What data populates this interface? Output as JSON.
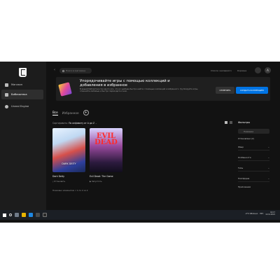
{
  "sidebar": {
    "logo": "epic-games-logo",
    "items": [
      {
        "label": "Магазин",
        "icon": "tag-icon",
        "active": false
      },
      {
        "label": "Библиотека",
        "icon": "grid-icon",
        "active": true
      },
      {
        "label": "Unreal Engine",
        "icon": "unreal-icon",
        "active": false
      }
    ]
  },
  "topbar": {
    "back_icon": "chevron-left-icon",
    "search_placeholder": "Поиск в магазине",
    "nav": [
      "Список желаемого",
      "Корзина"
    ],
    "friends_icon": "friends-icon",
    "avatar_label": "A"
  },
  "banner": {
    "title": "Упорядочивайте игры с помощью коллекций и добавления в избранное",
    "text": "В вашей библиотеке так много игр, что их удобнее быстро найти с помощью коллекций и избранного. Группируйте игры, отмечайте любимые и быстро переходите к ним.",
    "dismiss_label": "ОТМЕНИТЬ",
    "create_label": "СОЗДАТЬ КОЛЛЕКЦИЮ"
  },
  "tabs": [
    "Все",
    "Избранное"
  ],
  "sort": {
    "label": "Сортировать:",
    "value": "По алфавиту от А до Z"
  },
  "games": [
    {
      "title": "Dark Deity",
      "status": "Установить",
      "cover_text": "DARK DEITY"
    },
    {
      "title": "Evil Dead: The Game",
      "status": "Запустить",
      "cover_text": "EVIL DEAD"
    }
  ],
  "shown_text": "Показано элементов: с 1 по 2 из 2",
  "filters": {
    "title": "Фильтры",
    "search_placeholder": "Название",
    "installed_label": "Установлено (2)",
    "groups": [
      "Жанр",
      "Особенности",
      "Типы",
      "Платформа"
    ],
    "last_label": "Приложения"
  },
  "tray": {
    "weather": "-4°C Облачно",
    "lang": "РУС",
    "time": "16:17",
    "date": "12.12.2021"
  },
  "colors": {
    "accent": "#0074e4",
    "bg": "#121212",
    "sidebar": "#1c1c1c"
  }
}
